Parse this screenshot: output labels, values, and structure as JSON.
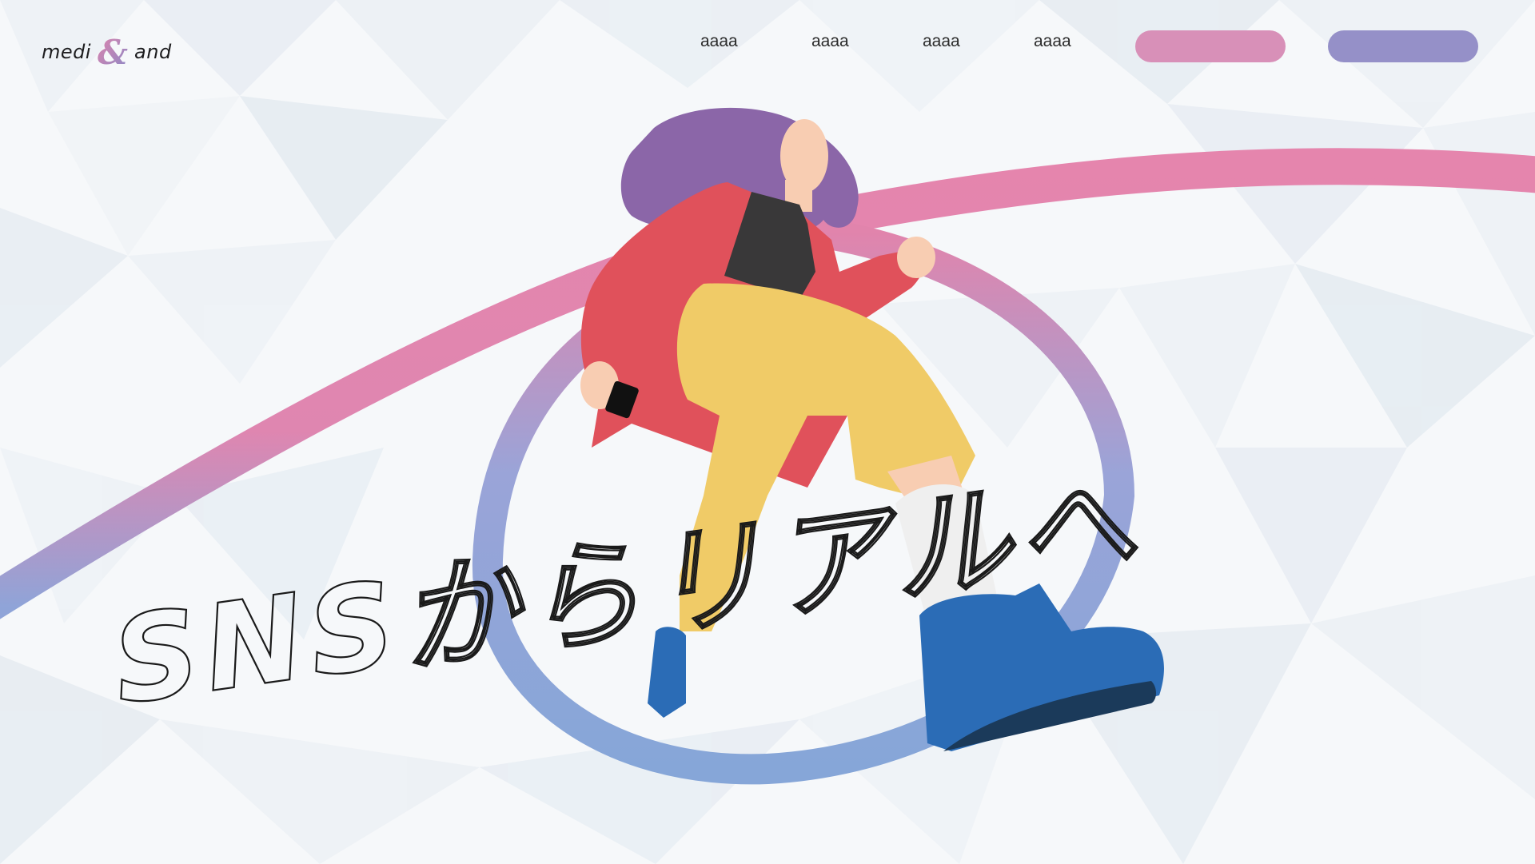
{
  "brand": {
    "left_text": "medi",
    "symbol": "&",
    "right_text": "and"
  },
  "nav": {
    "items": [
      "aaaa",
      "aaaa",
      "aaaa",
      "aaaa"
    ]
  },
  "cta_buttons": [
    {
      "name": "primary-cta",
      "color": "#d890b8",
      "label": ""
    },
    {
      "name": "secondary-cta",
      "color": "#9590c8",
      "label": ""
    }
  ],
  "hero": {
    "headline": "SNSからリアルへ"
  },
  "colors": {
    "background": "#f6f8fa",
    "ribbon_pink": "#e184ac",
    "ribbon_blue": "#86a6d8",
    "hair": "#8b66a8",
    "jacket": "#e0515b",
    "pants": "#f0cb67",
    "shoe": "#2b6cb6"
  }
}
